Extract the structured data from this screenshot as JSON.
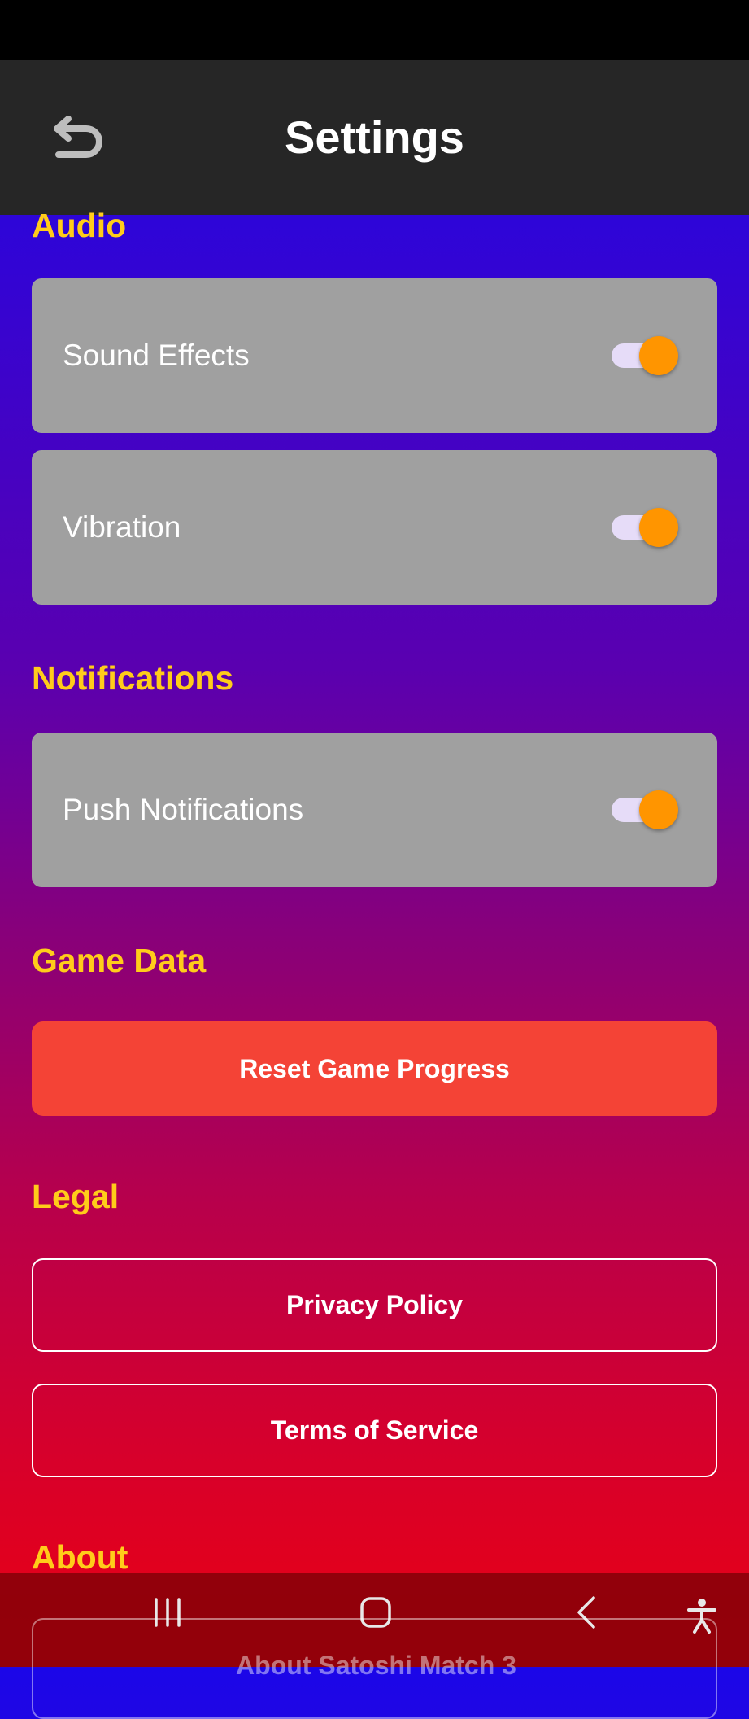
{
  "header": {
    "title": "Settings"
  },
  "sections": {
    "audio": "Audio",
    "notifications": "Notifications",
    "game_data": "Game Data",
    "legal": "Legal",
    "about": "About"
  },
  "settings": {
    "sound_effects": {
      "label": "Sound Effects",
      "enabled": true
    },
    "vibration": {
      "label": "Vibration",
      "enabled": true
    },
    "push_notifications": {
      "label": "Push Notifications",
      "enabled": true
    }
  },
  "buttons": {
    "reset": "Reset Game Progress",
    "privacy": "Privacy Policy",
    "terms": "Terms of Service",
    "about": "About Satoshi Match 3"
  },
  "colors": {
    "section_label": "#ffcc1a",
    "toggle_thumb": "#ff9500",
    "reset_button": "#f44336",
    "app_bar": "#262626"
  },
  "icons": {
    "back": "back-arrow-icon",
    "nav_recents": "recents-icon",
    "nav_home": "home-icon",
    "nav_back": "nav-back-icon",
    "accessibility": "accessibility-icon"
  }
}
